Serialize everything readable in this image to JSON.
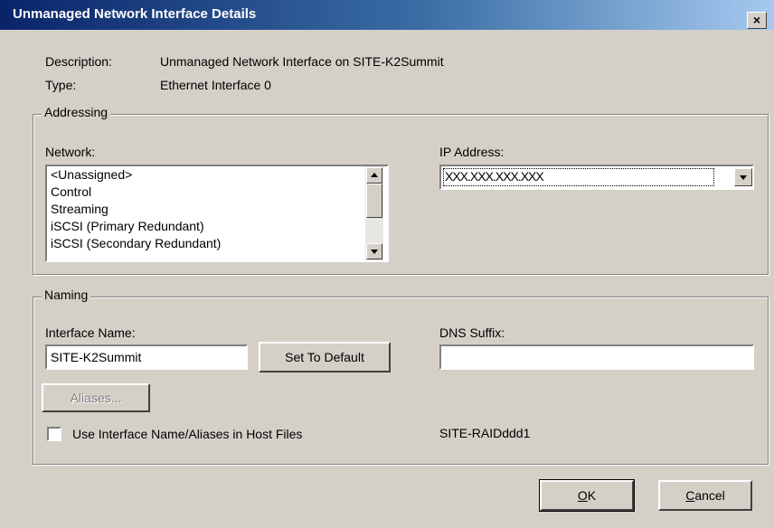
{
  "window": {
    "title": "Unmanaged Network Interface Details",
    "close_label": "×"
  },
  "info": {
    "description_label": "Description:",
    "description_value": "Unmanaged Network Interface on SITE-K2Summit",
    "type_label": "Type:",
    "type_value": "Ethernet Interface 0"
  },
  "addressing": {
    "legend": "Addressing",
    "network_label": "Network:",
    "network_items": [
      "<Unassigned>",
      "Control",
      "Streaming",
      "iSCSI (Primary Redundant)",
      "iSCSI (Secondary Redundant)"
    ],
    "ip_label": "IP Address:",
    "ip_value": "XXX.XXX.XXX.XXX"
  },
  "naming": {
    "legend": "Naming",
    "interface_name_label": "Interface Name:",
    "interface_name_value": "SITE-K2Summit",
    "set_default_label": "Set To Default",
    "dns_label": "DNS Suffix:",
    "dns_value": "",
    "aliases_label": "Aliases...",
    "host_files_label": "Use Interface Name/Aliases in Host Files",
    "host_files_checked": false,
    "raid_name": "SITE-RAIDddd1"
  },
  "buttons": {
    "ok_mnemonic": "O",
    "ok_rest": "K",
    "cancel_mnemonic": "C",
    "cancel_rest": "ancel"
  }
}
